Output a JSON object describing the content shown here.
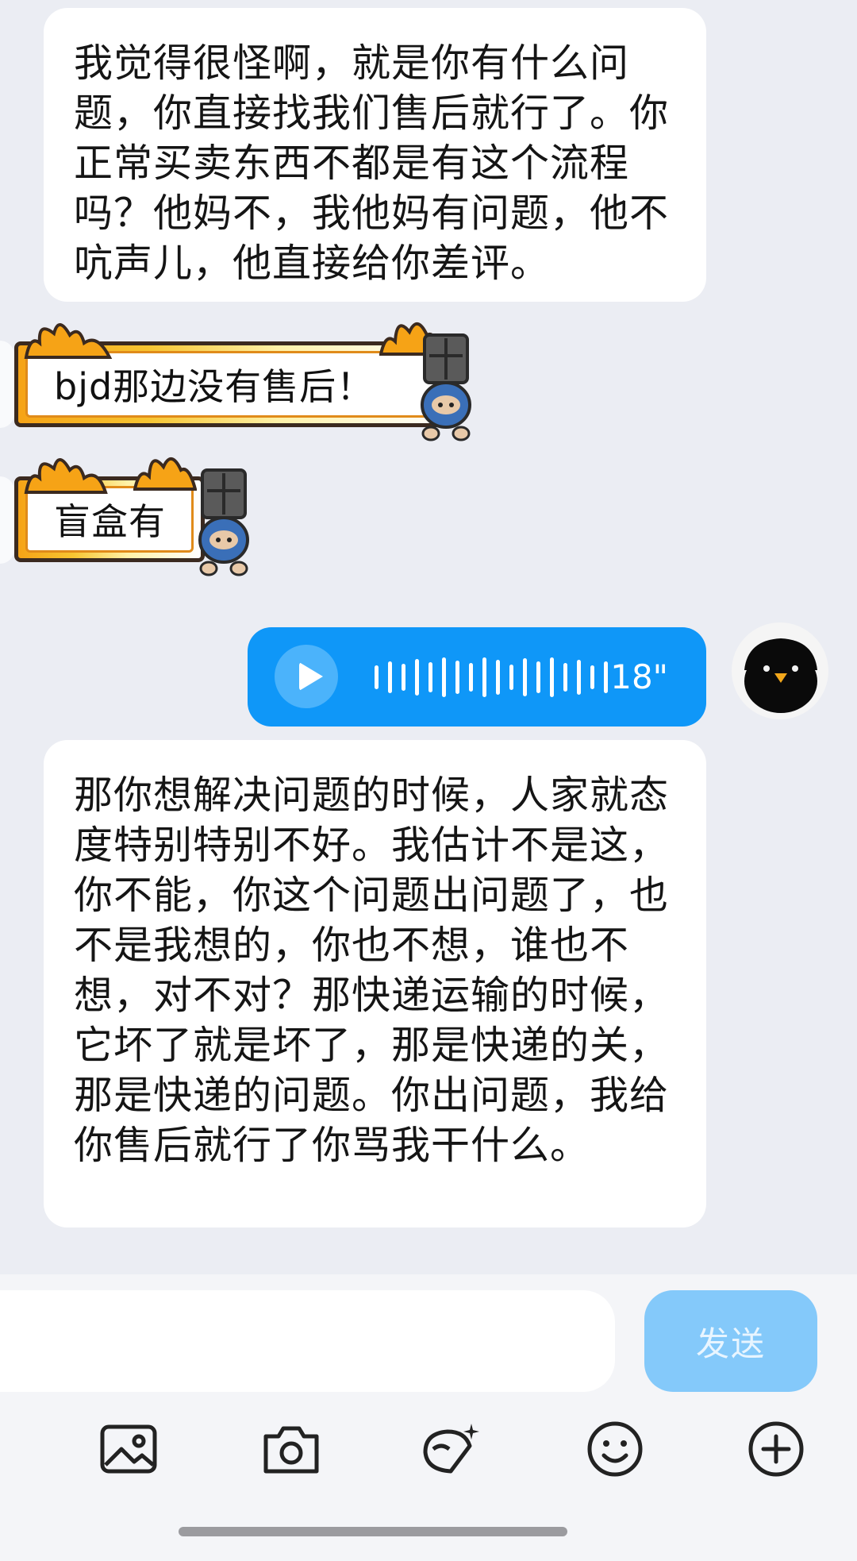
{
  "messages": {
    "m1": "我觉得很怪啊，就是你有什么问题，你直接找我们售后就行了。你正常买卖东西不都是有这个流程吗？他妈不，我他妈有问题，他不吭声儿，他直接给你差评。",
    "m2": "bjd那边没有售后！",
    "m3": "盲盒有",
    "voice_duration": "18\"",
    "m4": "那你想解决问题的时候，人家就态度特别特别不好。我估计不是这，你不能，你这个问题出问题了，也不是我想的，你也不想，谁也不想，对不对？那快递运输的时候，它坏了就是坏了，那是快递的关，那是快递的问题。你出问题，我给你售后就行了你骂我干什么。"
  },
  "composer": {
    "send_label": "发送"
  },
  "toolbar": [
    "image-icon",
    "camera-icon",
    "sticker-icon",
    "emoji-icon",
    "plus-icon"
  ],
  "colors": {
    "voice_bubble": "#0f97f8",
    "send_button": "#84c9fa",
    "chat_bg": "#ebedf3"
  }
}
